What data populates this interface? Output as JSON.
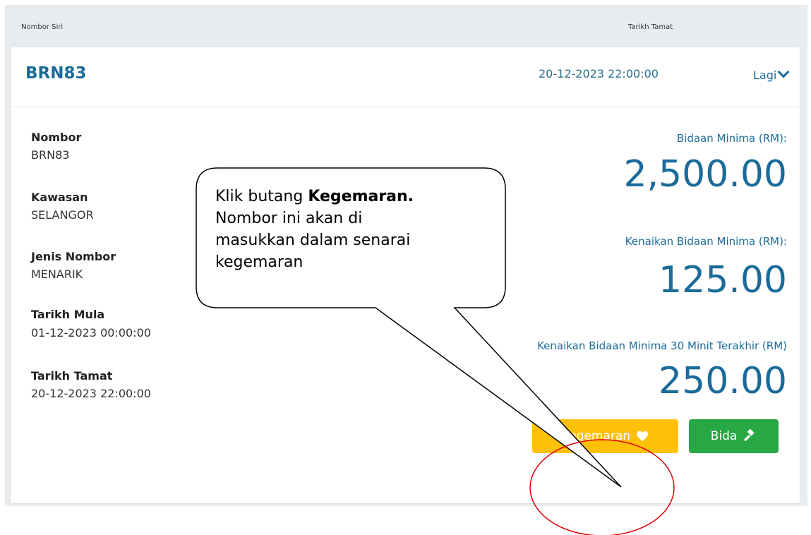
{
  "table": {
    "col_serial": "Nombor Siri",
    "col_end": "Tarikh Tamat"
  },
  "card": {
    "serial": "BRN83",
    "end_datetime": "20-12-2023 22:00:00",
    "more_label": "Lagi"
  },
  "details": {
    "nombor_label": "Nombor",
    "nombor_value": "BRN83",
    "kawasan_label": "Kawasan",
    "kawasan_value": "SELANGOR",
    "jenis_label": "Jenis Nombor",
    "jenis_value": "MENARIK",
    "mula_label": "Tarikh Mula",
    "mula_value": "01-12-2023 00:00:00",
    "tamat_label": "Tarikh Tamat",
    "tamat_value": "20-12-2023 22:00:00"
  },
  "bids": {
    "min_label": "Bidaan Minima (RM):",
    "min_value": "2,500.00",
    "inc_label": "Kenaikan Bidaan Minima (RM):",
    "inc_value": "125.00",
    "inc30_label": "Kenaikan Bidaan Minima 30 Minit Terakhir (RM)",
    "inc30_value": "250.00"
  },
  "buttons": {
    "favourite_label": "Kegemaran",
    "bid_label": "Bida"
  },
  "callout": {
    "line1_prefix": "Klik butang ",
    "line1_bold": "Kegemaran.",
    "line2": "Nombor ini akan di",
    "line3": "masukkan dalam senarai",
    "line4": "kegemaran"
  },
  "icons": {
    "chevron": "chevron-down-icon",
    "heart": "heart-icon",
    "gavel": "gavel-icon"
  },
  "colors": {
    "primary": "#1b6b9a",
    "favourite": "#ffc107",
    "bid": "#28a745",
    "highlight_circle": "#e00000"
  }
}
